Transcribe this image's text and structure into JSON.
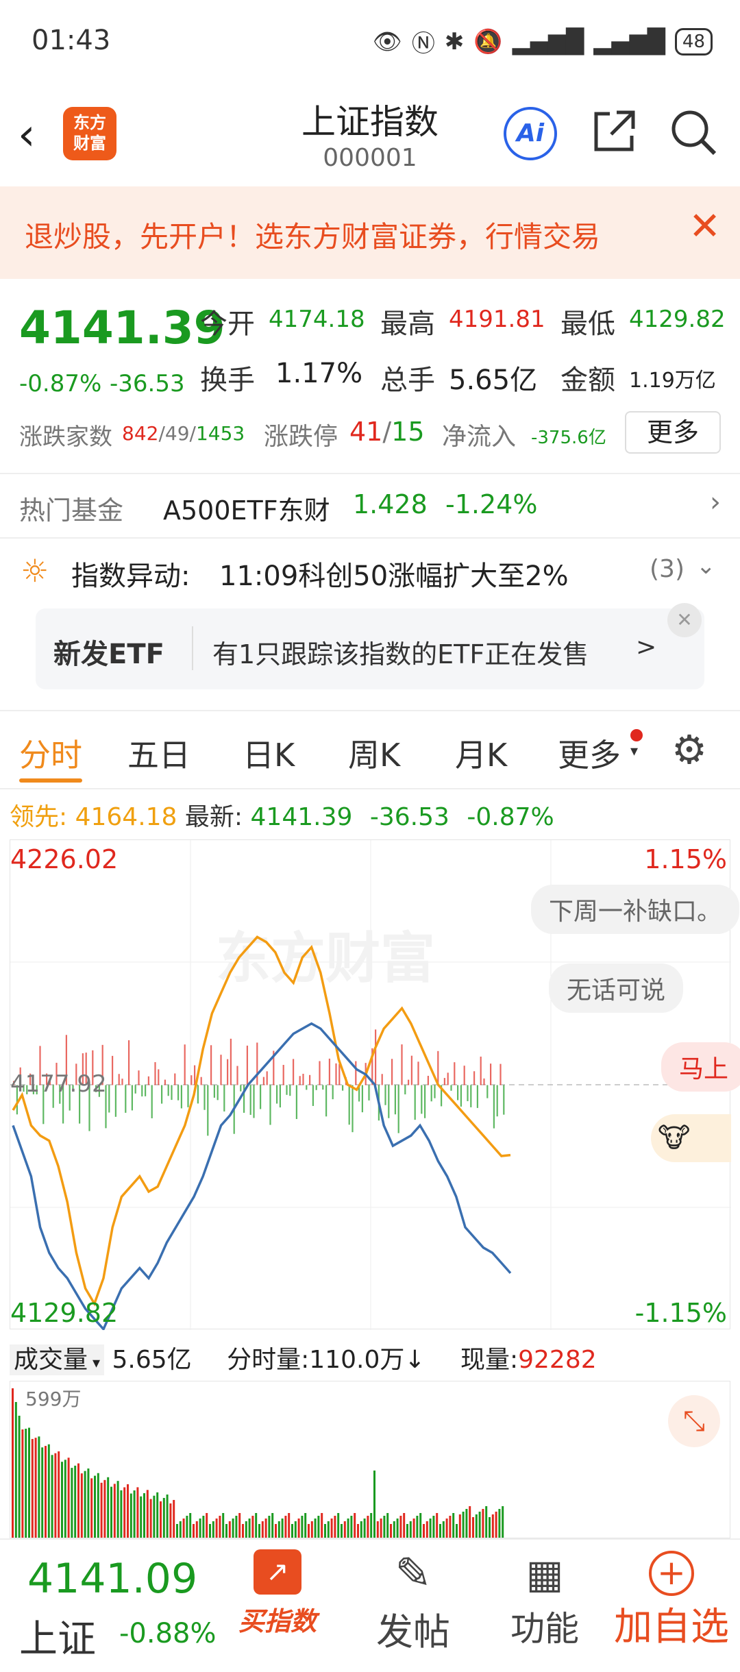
{
  "status_bar": {
    "time": "01:43",
    "battery": "48"
  },
  "header": {
    "logo_text_1": "东方",
    "logo_text_2": "财富",
    "title": "上证指数",
    "code": "000001",
    "ai_label": "Ai"
  },
  "banner": {
    "text": "退炒股，先开户！选东方财富证券，行情交易"
  },
  "quote": {
    "price": "4141.39",
    "change_pct": "-0.87%",
    "change": "-36.53",
    "open_label": "今开",
    "open": "4174.18",
    "high_label": "最高",
    "high": "4191.81",
    "low_label": "最低",
    "low": "4129.82",
    "turnover_label": "换手",
    "turnover": "1.17%",
    "volume_label": "总手",
    "volume": "5.65亿",
    "amount_label": "金额",
    "amount": "1.19万亿",
    "breadth_label": "涨跌家数",
    "breadth_up": "842",
    "breadth_sep1": "/",
    "breadth_flat": "49",
    "breadth_sep2": "/",
    "breadth_down": "1453",
    "limit_label": "涨跌停",
    "limit_up": "41",
    "limit_sep": "/",
    "limit_down": "15",
    "netflow_label": "净流入",
    "netflow": "-375.6亿",
    "more_button": "更多"
  },
  "hot_fund": {
    "label": "热门基金",
    "name": "A500ETF东财",
    "price": "1.428",
    "change": "-1.24%"
  },
  "alert": {
    "label": "指数异动:",
    "text": "11:09科创50涨幅扩大至2%",
    "count": "(3)"
  },
  "etf_card": {
    "title": "新发ETF",
    "text": "有1只跟踪该指数的ETF正在发售",
    "arrow": ">"
  },
  "tabs": [
    "分时",
    "五日",
    "日K",
    "周K",
    "月K",
    "更多"
  ],
  "info_line": {
    "lead_label": "领先:",
    "lead": "4164.18",
    "latest_label": "最新:",
    "latest": "4141.39",
    "change": "-36.53",
    "change_pct": "-0.87%"
  },
  "chart_labels": {
    "top_left": "4226.02",
    "top_right": "1.15%",
    "mid_left": "4177.92",
    "bottom_left": "4129.82",
    "bottom_right": "-1.15%",
    "watermark": "东方财富"
  },
  "bubbles": [
    "下周一补缺口。",
    "无话可说",
    "马上"
  ],
  "volume_line": {
    "label": "成交量",
    "total": "5.65亿",
    "minute_label": "分时量:",
    "minute": "110.0万",
    "minute_arrow": "↓",
    "current_label": "现量:",
    "current": "92282",
    "scale": "599万"
  },
  "bottom": {
    "price": "4141.09",
    "name": "上证",
    "change": "-0.88%",
    "buy_label": "买指数",
    "post_label": "发帖",
    "func_label": "功能",
    "add_label": "加自选"
  },
  "colors": {
    "up": "#e0281e",
    "down": "#1a9a20",
    "accent": "#f39700",
    "line_price": "#3a6fb0",
    "line_lead": "#f39c12"
  },
  "chart_data": {
    "type": "line",
    "ylim": [
      4129.82,
      4226.02
    ],
    "baseline": 4177.92,
    "series": [
      {
        "values": [
          4170,
          4165,
          4160,
          4150,
          4145,
          4142,
          4140,
          4137,
          4134,
          4132,
          4130,
          4134,
          4138,
          4140,
          4142,
          4140,
          4143,
          4147,
          4150,
          4153,
          4156,
          4160,
          4165,
          4170,
          4172,
          4175,
          4178,
          4180,
          4182,
          4184,
          4186,
          4188,
          4189,
          4190,
          4189,
          4187,
          4185,
          4183,
          4181,
          4180,
          4178,
          4170,
          4166,
          4167,
          4168,
          4170,
          4167,
          4163,
          4160,
          4156,
          4150,
          4148,
          4146,
          4145,
          4143,
          4141
        ]
      },
      {
        "values": [
          4173,
          4176,
          4170,
          4168,
          4167,
          4162,
          4155,
          4145,
          4138,
          4135,
          4140,
          4150,
          4156,
          4158,
          4160,
          4157,
          4158,
          4162,
          4166,
          4170,
          4176,
          4185,
          4192,
          4196,
          4200,
          4203,
          4205,
          4207,
          4206,
          4204,
          4200,
          4198,
          4203,
          4205,
          4200,
          4192,
          4183,
          4178,
          4177,
          4180,
          4185,
          4189,
          4191,
          4193,
          4190,
          4186,
          4182,
          4178,
          4176,
          4174,
          4172,
          4170,
          4168,
          4166,
          4164,
          4164.18
        ]
      }
    ]
  }
}
